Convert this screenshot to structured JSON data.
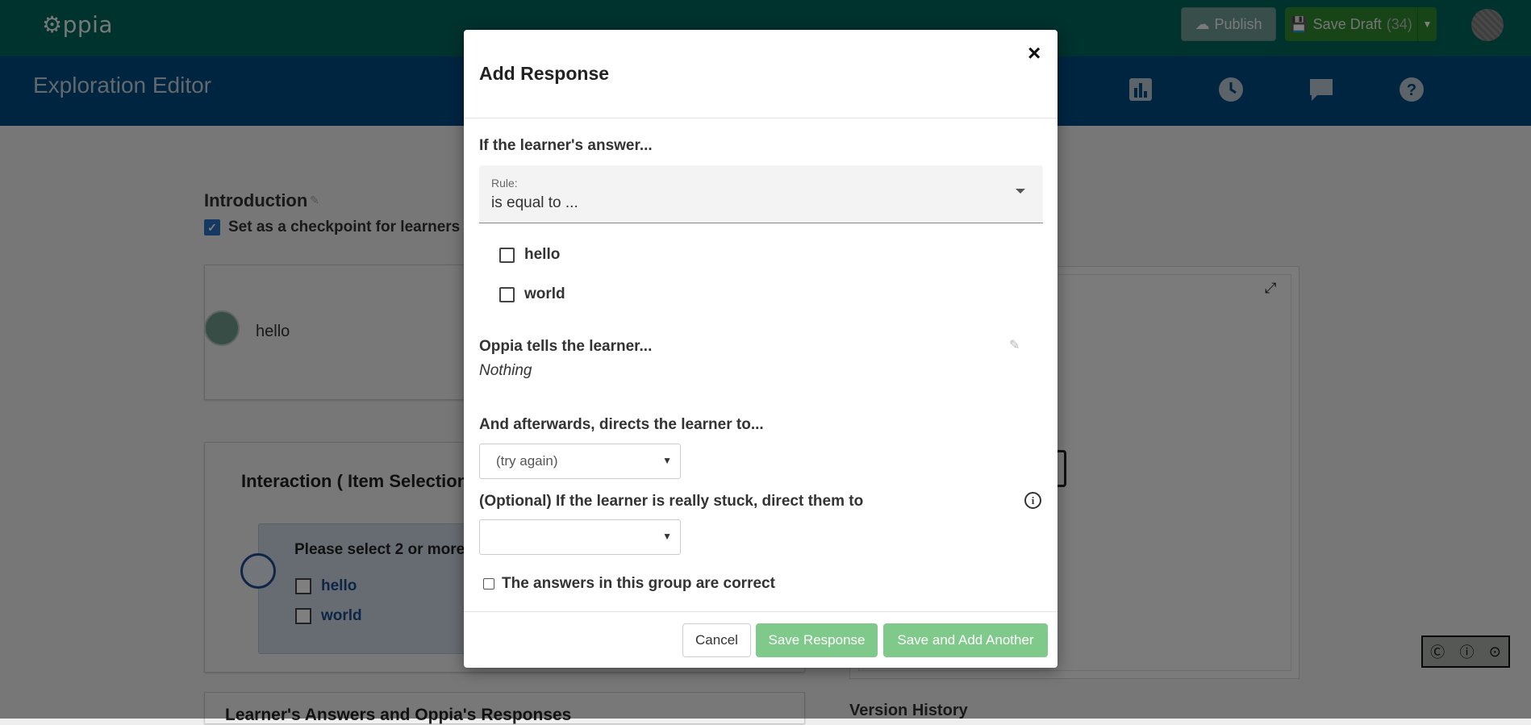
{
  "app": {
    "logo_text": "⚙ppia"
  },
  "topbar": {
    "publish_label": "Publish",
    "save_draft_label": "Save Draft",
    "save_draft_count": "(34)"
  },
  "navbar": {
    "title": "Exploration Editor",
    "icons": [
      "stats-icon",
      "history-icon",
      "feedback-icon",
      "help-icon"
    ]
  },
  "background": {
    "state_name": "Introduction",
    "checkpoint_label": "Set as a checkpoint for learners",
    "content_text": "hello",
    "interaction_title": "Interaction ( Item Selection",
    "interaction_prompt": "Please select 2 or more",
    "choices": [
      "hello",
      "world"
    ],
    "responses_title": "Learner's Answers and Oppia's Responses",
    "version_history": "Version History",
    "license_badge": "cc by sa"
  },
  "modal": {
    "title": "Add Response",
    "close_label": "×",
    "learner_answer_label": "If the learner's answer...",
    "rule_caption": "Rule:",
    "rule_value": "is equal to ...",
    "options": [
      "hello",
      "world"
    ],
    "feedback_label": "Oppia tells the learner...",
    "feedback_value": "Nothing",
    "destination_label": "And afterwards, directs the learner to...",
    "destination_value": "(try again)",
    "stuck_label": "(Optional) If the learner is really stuck, direct them to",
    "stuck_value": "",
    "correct_label": "The answers in this group are correct",
    "cancel_label": "Cancel",
    "save_label": "Save Response",
    "save_add_label": "Save and Add Another"
  },
  "colors": {
    "topbar": "#00645c",
    "navbar": "#004a82",
    "save_green": "#7fc98a",
    "draft_green": "#2e8b2e"
  }
}
